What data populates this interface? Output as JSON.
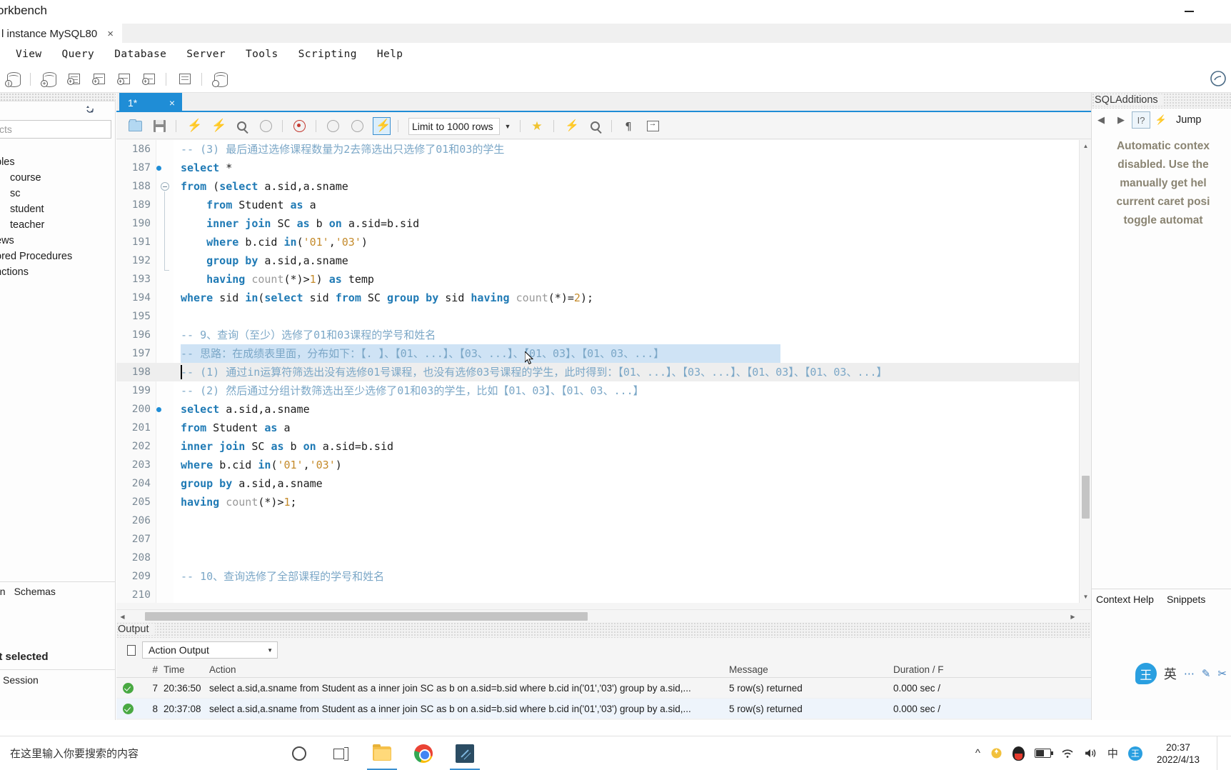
{
  "window": {
    "title": "orkbench",
    "minimize_label": "minimize"
  },
  "instance_tab": {
    "label": "l instance MySQL80",
    "close": "×"
  },
  "menubar": {
    "items": [
      "View",
      "Query",
      "Database",
      "Server",
      "Tools",
      "Scripting",
      "Help"
    ]
  },
  "sidebar": {
    "search_placeholder": "cts",
    "refresh_icon": "refresh-icon",
    "tree": [
      {
        "label": "bles",
        "level": 0
      },
      {
        "label": "course",
        "level": 1
      },
      {
        "label": "sc",
        "level": 1
      },
      {
        "label": "student",
        "level": 1
      },
      {
        "label": "teacher",
        "level": 1
      },
      {
        "label": "ews",
        "level": 0
      },
      {
        "label": "ored Procedures",
        "level": 0
      },
      {
        "label": "nctions",
        "level": 0
      }
    ],
    "footer_tabs": [
      "on",
      "Schemas"
    ],
    "no_selection": "ct selected",
    "session_label": "Session"
  },
  "sql_editor": {
    "tab_label": "1*",
    "tab_close": "×",
    "limit_label": "Limit to 1000 rows",
    "toolbar_icons": [
      "open-script-icon",
      "save-script-icon",
      "execute-icon",
      "execute-current-statement-icon",
      "explain-icon",
      "stop-icon",
      "stop-on-error-icon",
      "commit-icon",
      "rollback-icon",
      "autocommit-icon",
      "beautify-icon",
      "find-icon",
      "toggle-invisible-chars-icon",
      "wrap-lines-icon"
    ],
    "lines": [
      {
        "no": "186",
        "marker": false,
        "html": "<span class='cmt'>--  (3) 最后通过选修课程数量为2去筛选出只选修了01和03的学生</span>",
        "state": "normal"
      },
      {
        "no": "187",
        "marker": true,
        "html": "<span class='kw'>select</span> <span class='pln'>*</span>",
        "state": "normal"
      },
      {
        "no": "188",
        "marker": false,
        "html": "<span class='kw'>from</span> <span class='pln'>(</span><span class='kw'>select</span> <span class='pln'>a.sid,a.sname</span>",
        "state": "normal"
      },
      {
        "no": "189",
        "marker": false,
        "html": "<span class='pln'>&nbsp;&nbsp;&nbsp;&nbsp;</span><span class='kw'>from</span> <span class='pln'>Student</span> <span class='kw'>as</span> <span class='pln'>a</span>",
        "state": "normal"
      },
      {
        "no": "190",
        "marker": false,
        "html": "<span class='pln'>&nbsp;&nbsp;&nbsp;&nbsp;</span><span class='kw'>inner join</span> <span class='pln'>SC</span> <span class='kw'>as</span> <span class='pln'>b</span> <span class='kw'>on</span> <span class='pln'>a.sid=b.sid</span>",
        "state": "normal"
      },
      {
        "no": "191",
        "marker": false,
        "html": "<span class='pln'>&nbsp;&nbsp;&nbsp;&nbsp;</span><span class='kw'>where</span> <span class='pln'>b.cid</span> <span class='kw'>in</span><span class='pln'>(</span><span class='str'>'01'</span><span class='pln'>,</span><span class='str'>'03'</span><span class='pln'>)</span>",
        "state": "normal"
      },
      {
        "no": "192",
        "marker": false,
        "html": "<span class='pln'>&nbsp;&nbsp;&nbsp;&nbsp;</span><span class='kw'>group by</span> <span class='pln'>a.sid,a.sname</span>",
        "state": "normal"
      },
      {
        "no": "193",
        "marker": false,
        "html": "<span class='pln'>&nbsp;&nbsp;&nbsp;&nbsp;</span><span class='kw'>having</span> <span class='fn'>count</span><span class='pln'>(*)&gt;</span><span class='num'>1</span><span class='pln'>)</span> <span class='kw'>as</span> <span class='pln'>temp</span>",
        "state": "normal"
      },
      {
        "no": "194",
        "marker": false,
        "html": "<span class='kw'>where</span> <span class='pln'>sid</span> <span class='kw'>in</span><span class='pln'>(</span><span class='kw'>select</span> <span class='pln'>sid</span> <span class='kw'>from</span> <span class='pln'>SC</span> <span class='kw'>group by</span> <span class='pln'>sid</span> <span class='kw'>having</span> <span class='fn'>count</span><span class='pln'>(*)=</span><span class='num'>2</span><span class='pln'>);</span>",
        "state": "normal"
      },
      {
        "no": "195",
        "marker": false,
        "html": "",
        "state": "normal"
      },
      {
        "no": "196",
        "marker": false,
        "html": "<span class='cmt'>-- 9、查询（至少）选修了01和03课程的学号和姓名</span>",
        "state": "normal"
      },
      {
        "no": "197",
        "marker": false,
        "html": "<span class='cmt'>-- 思路：在成绩表里面，分布如下：【. 】、【01、...】、【03、...】、【01、03】、【01、03、...】</span>",
        "state": "selected"
      },
      {
        "no": "198",
        "marker": false,
        "html": "<span class='cmt'>--  (1) 通过in运算符筛选出没有选修01号课程，也没有选修03号课程的学生，此时得到：【01、...】、【03、...】、【01、03】、【01、03、...】</span>",
        "state": "current"
      },
      {
        "no": "199",
        "marker": false,
        "html": "<span class='cmt'>--  (2) 然后通过分组计数筛选出至少选修了01和03的学生，比如【01、03】、【01、03、...】</span>",
        "state": "normal"
      },
      {
        "no": "200",
        "marker": true,
        "html": "<span class='kw'>select</span> <span class='pln'>a.sid,a.sname</span>",
        "state": "normal"
      },
      {
        "no": "201",
        "marker": false,
        "html": "<span class='kw'>from</span> <span class='pln'>Student</span> <span class='kw'>as</span> <span class='pln'>a</span>",
        "state": "normal"
      },
      {
        "no": "202",
        "marker": false,
        "html": "<span class='kw'>inner join</span> <span class='pln'>SC</span> <span class='kw'>as</span> <span class='pln'>b</span> <span class='kw'>on</span> <span class='pln'>a.sid=b.sid</span>",
        "state": "normal"
      },
      {
        "no": "203",
        "marker": false,
        "html": "<span class='kw'>where</span> <span class='pln'>b.cid</span> <span class='kw'>in</span><span class='pln'>(</span><span class='str'>'01'</span><span class='pln'>,</span><span class='str'>'03'</span><span class='pln'>)</span>",
        "state": "normal"
      },
      {
        "no": "204",
        "marker": false,
        "html": "<span class='kw'>group by</span> <span class='pln'>a.sid,a.sname</span>",
        "state": "normal"
      },
      {
        "no": "205",
        "marker": false,
        "html": "<span class='kw'>having</span> <span class='fn'>count</span><span class='pln'>(*)&gt;</span><span class='num'>1</span><span class='pln'>;</span>",
        "state": "normal"
      },
      {
        "no": "206",
        "marker": false,
        "html": "",
        "state": "normal"
      },
      {
        "no": "207",
        "marker": false,
        "html": "",
        "state": "normal"
      },
      {
        "no": "208",
        "marker": false,
        "html": "",
        "state": "normal"
      },
      {
        "no": "209",
        "marker": false,
        "html": "<span class='cmt'>-- 10、查询选修了全部课程的学号和姓名</span>",
        "state": "normal"
      },
      {
        "no": "210",
        "marker": false,
        "html": "",
        "state": "normal"
      }
    ]
  },
  "output": {
    "panel_title": "Output",
    "select_value": "Action Output",
    "columns": [
      "#",
      "Time",
      "Action",
      "Message",
      "Duration / F"
    ],
    "rows": [
      {
        "status": "success",
        "num": "7",
        "time": "20:36:50",
        "action": "select a.sid,a.sname from Student as a inner join SC as b on a.sid=b.sid where b.cid in('01','03') group by a.sid,...",
        "message": "5 row(s) returned",
        "duration": "0.000 sec /"
      },
      {
        "status": "success",
        "num": "8",
        "time": "20:37:08",
        "action": "select a.sid,a.sname from Student as a inner join SC as b on a.sid=b.sid where b.cid in('01','03') group by a.sid,...",
        "message": "5 row(s) returned",
        "duration": "0.000 sec /"
      }
    ]
  },
  "right_panel": {
    "title": "SQLAdditions",
    "jump_label": "Jump",
    "message_lines": [
      "Automatic contex",
      "disabled. Use the",
      "manually get hel",
      "current caret posi",
      "toggle automat"
    ],
    "bottom_tabs": [
      "Context Help",
      "Snippets"
    ],
    "ime": {
      "logo": "王",
      "mode": "英"
    }
  },
  "taskbar": {
    "search_placeholder": "在这里输入你要搜索的内容",
    "buttons": [
      "cortana-icon",
      "task-view-icon",
      "file-explorer-icon",
      "chrome-icon",
      "mysql-workbench-icon"
    ],
    "tray_icons": [
      "show-hidden-icons",
      "update-icon",
      "qq-icon",
      "battery-icon",
      "wifi-icon",
      "volume-icon",
      "ime-chinese-icon",
      "ime-sogou-icon"
    ],
    "ime_lang": "中",
    "clock_time": "20:37",
    "clock_date": "2022/4/13"
  },
  "colors": {
    "accent": "#1f8dd6",
    "selection": "#cfe3f5",
    "keyword": "#1f7ab5",
    "comment": "#7ba7c7",
    "string": "#c48a2a",
    "success": "#49a942"
  }
}
